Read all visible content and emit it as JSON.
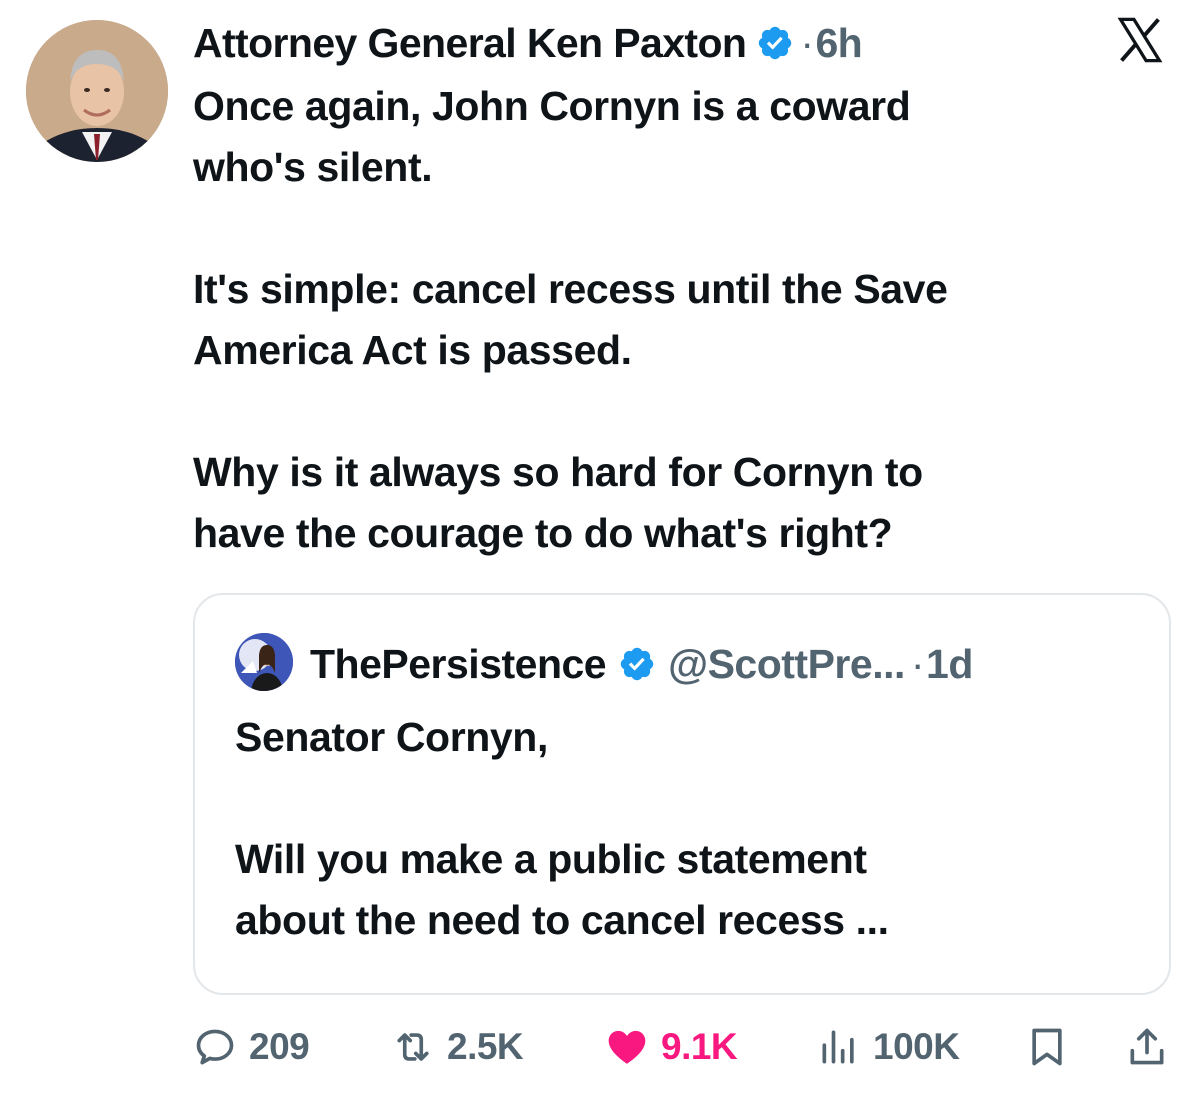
{
  "tweet": {
    "author_name": "Attorney General Ken Paxton",
    "separator": "·",
    "timestamp": "6h",
    "text_lines": [
      "Once again, John Cornyn is a coward",
      "who's silent.",
      "It's simple: cancel recess until the Save",
      "America Act is passed.",
      "Why is it always so hard for Cornyn to",
      "have the courage to do what's right?"
    ]
  },
  "quoted_tweet": {
    "author_name": "ThePersistence",
    "handle": "@ScottPre...",
    "separator": "·",
    "timestamp": "1d",
    "text_lines": [
      "Senator Cornyn,",
      "Will you make a public statement",
      "about the need to cancel recess ..."
    ]
  },
  "actions": {
    "replies": "209",
    "reposts": "2.5K",
    "likes": "9.1K",
    "views": "100K"
  },
  "colors": {
    "verified_badge": "#1d9bf0",
    "like_active": "#f91880",
    "secondary_text": "#536471",
    "border": "#e3e7ea"
  },
  "icons": {
    "brand": "x-logo-icon",
    "verified": "verified-badge-icon",
    "reply": "reply-icon",
    "repost": "repost-icon",
    "like": "heart-filled-icon",
    "views": "views-bar-chart-icon",
    "bookmark": "bookmark-icon",
    "share": "share-icon"
  }
}
